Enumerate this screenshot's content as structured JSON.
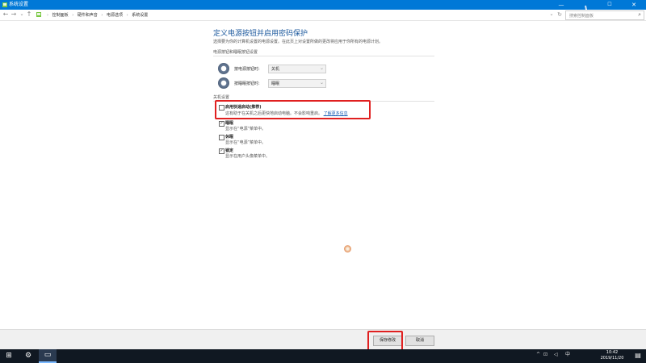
{
  "window": {
    "title": "系统设置",
    "min_glyph": "—",
    "max_glyph": "☐",
    "close_glyph": "✕"
  },
  "address": {
    "back_glyph": "←",
    "forward_glyph": "→",
    "dropdown_glyph": "⌄",
    "up_glyph": "↑",
    "crumb_root_glyph": "›",
    "breadcrumbs": [
      "控制面板",
      "硬件和声音",
      "电源选项",
      "系统设置"
    ],
    "search_placeholder": "搜索控制面板",
    "search_glyph": "⌕",
    "refresh_glyph": "↻",
    "chevron_glyph": "⌄"
  },
  "page": {
    "heading": "定义电源按钮并启用密码保护",
    "description": "选择要为你的计算机设置的电源设置。在此页上对设置所做的更改将应用于你所有的电源计划。",
    "power_section": {
      "title": "电源按钮和睡眠按钮设置",
      "rows": [
        {
          "label": "按电源按钮时:",
          "value": "关机"
        },
        {
          "label": "按睡眠按钮时:",
          "value": "睡眠"
        }
      ]
    },
    "shutdown_section": {
      "title": "关机设置",
      "options": [
        {
          "title": "启用快速启动(推荐)",
          "desc": "这有助于在关机之后更快地启动电脑。不会影响重启。",
          "link": "了解更多信息",
          "checked": false
        },
        {
          "title": "睡眠",
          "desc": "显示在“电源”菜单中。",
          "checked": true
        },
        {
          "title": "休眠",
          "desc": "显示在“电源”菜单中。",
          "checked": false
        },
        {
          "title": "锁定",
          "desc": "显示在用户头像菜单中。",
          "checked": true
        }
      ]
    }
  },
  "buttons": {
    "save": "保存修改",
    "cancel": "取消"
  },
  "taskbar": {
    "start_glyph": "⊞",
    "settings_glyph": "⚙",
    "app_glyph": "▭",
    "tray": {
      "expand_glyph": "^",
      "network_glyph": "⊡",
      "volume_glyph": "◁",
      "ime_label": "中"
    },
    "time": "10:42",
    "date": "2019/11/20",
    "notification_glyph": "▤"
  },
  "colors": {
    "title_bar": "#0078d7",
    "heading": "#1e5a9e",
    "highlight_box": "#e02020",
    "taskbar": "#101822"
  }
}
